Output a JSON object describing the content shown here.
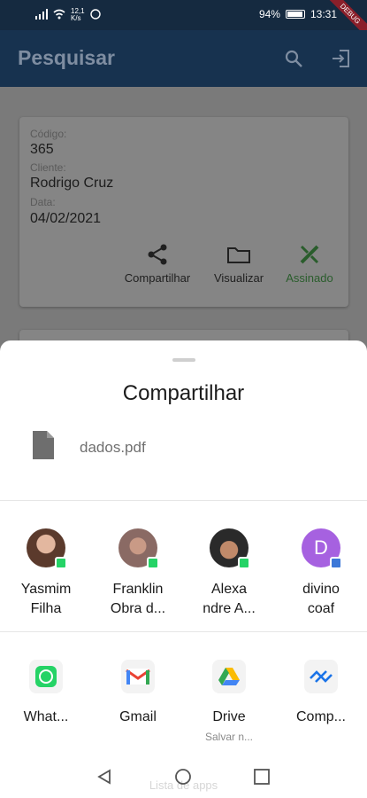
{
  "status_bar": {
    "net_speed_top": "12,1",
    "net_speed_bottom": "K/s",
    "battery_pct": "94%",
    "time": "13:31",
    "debug_label": "DEBUG"
  },
  "app": {
    "title": "Pesquisar",
    "card": {
      "code_label": "Código:",
      "code_value": "365",
      "client_label": "Cliente:",
      "client_value": "Rodrigo Cruz",
      "date_label": "Data:",
      "date_value": "04/02/2021",
      "actions": [
        "Compartilhar",
        "Visualizar",
        "Assinado"
      ]
    }
  },
  "share_sheet": {
    "title": "Compartilhar",
    "file_name": "dados.pdf",
    "contacts": [
      {
        "line1": "Yasmim",
        "line2": "Filha"
      },
      {
        "line1": "Franklin",
        "line2": "Obra d..."
      },
      {
        "line1": "Alexa",
        "line2": "ndre A..."
      },
      {
        "line1": "divino",
        "line2": "coaf",
        "initial": "D"
      }
    ],
    "apps": [
      {
        "label": "What...",
        "sub": ""
      },
      {
        "label": "Gmail",
        "sub": ""
      },
      {
        "label": "Drive",
        "sub": "Salvar n..."
      },
      {
        "label": "Comp...",
        "sub": ""
      }
    ],
    "hint": "Lista de apps"
  },
  "colors": {
    "whatsapp": "#25d366",
    "assinado": "#2a5d2c",
    "app_bar": "#17324f",
    "divino_avatar": "#a661e0"
  }
}
